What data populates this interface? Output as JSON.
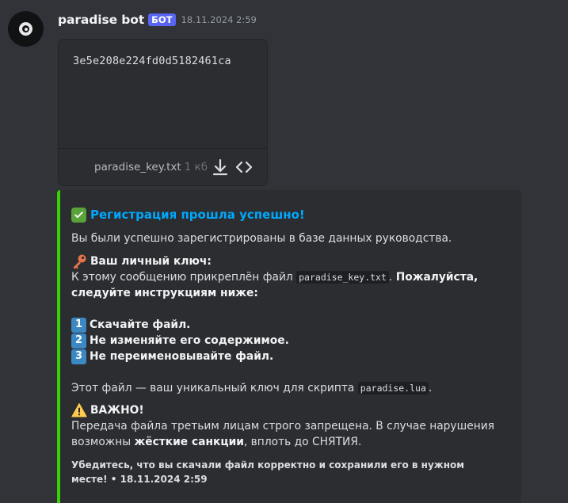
{
  "author": {
    "name": "paradise bot",
    "tag": "БОТ",
    "timestamp": "18.11.2024 2:59"
  },
  "attachment": {
    "preview_text": "3e5e208e224fd0d5182461ca",
    "file_name": "paradise_key.txt",
    "file_size": "1 кб",
    "icons": [
      "download-icon",
      "code-view-icon"
    ]
  },
  "embed": {
    "accent_color": "#36d400",
    "title_emoji": "check-mark-icon",
    "title": "Регистрация прошла успешно!",
    "intro": "Вы были успешно зарегистрированы в базе данных руководства.",
    "key_heading_emoji": "key-icon",
    "key_heading": "Ваш личный ключ:",
    "attach_line_prefix": "К этому сообщению прикреплён файл",
    "attach_line_code": "paradise_key.txt",
    "attach_line_bold": "Пожалуйста,",
    "attach_line2_bold": "следуйте инструкциям ниже:",
    "steps": [
      {
        "num": "1",
        "text": "Скачайте файл."
      },
      {
        "num": "2",
        "text": "Не изменяйте его содержимое."
      },
      {
        "num": "3",
        "text": "Не переименовывайте файл."
      }
    ],
    "unique_prefix": "Этот файл — ваш уникальный ключ для скрипта",
    "unique_code": "paradise.lua",
    "unique_suffix": ".",
    "warning_emoji": "warning-icon",
    "warning_heading": "ВАЖНО!",
    "warning_line1": "Передача файла третьим лицам строго запрещена. В случае нарушения",
    "warning_line2_prefix": "возможны",
    "warning_line2_bold": "жёсткие санкции",
    "warning_line2_suffix": ", вплоть до СНЯТИЯ.",
    "footer": "Убедитесь, что вы скачали файл корректно и сохранили его в нужном месте! • 18.11.2024 2:59"
  }
}
